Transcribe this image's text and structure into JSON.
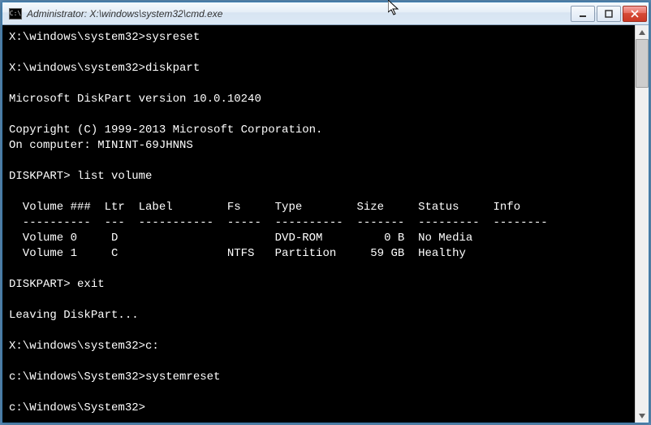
{
  "window": {
    "title": "Administrator: X:\\windows\\system32\\cmd.exe",
    "icon_label": "C:\\"
  },
  "terminal": {
    "lines": [
      "X:\\windows\\system32>sysreset",
      "",
      "X:\\windows\\system32>diskpart",
      "",
      "Microsoft DiskPart version 10.0.10240",
      "",
      "Copyright (C) 1999-2013 Microsoft Corporation.",
      "On computer: MININT-69JHNNS",
      "",
      "DISKPART> list volume",
      "",
      "  Volume ###  Ltr  Label        Fs     Type        Size     Status     Info",
      "  ----------  ---  -----------  -----  ----------  -------  ---------  --------",
      "  Volume 0     D                       DVD-ROM         0 B  No Media",
      "  Volume 1     C                NTFS   Partition     59 GB  Healthy",
      "",
      "DISKPART> exit",
      "",
      "Leaving DiskPart...",
      "",
      "X:\\windows\\system32>c:",
      "",
      "c:\\Windows\\System32>systemreset",
      "",
      "c:\\Windows\\System32>"
    ]
  }
}
